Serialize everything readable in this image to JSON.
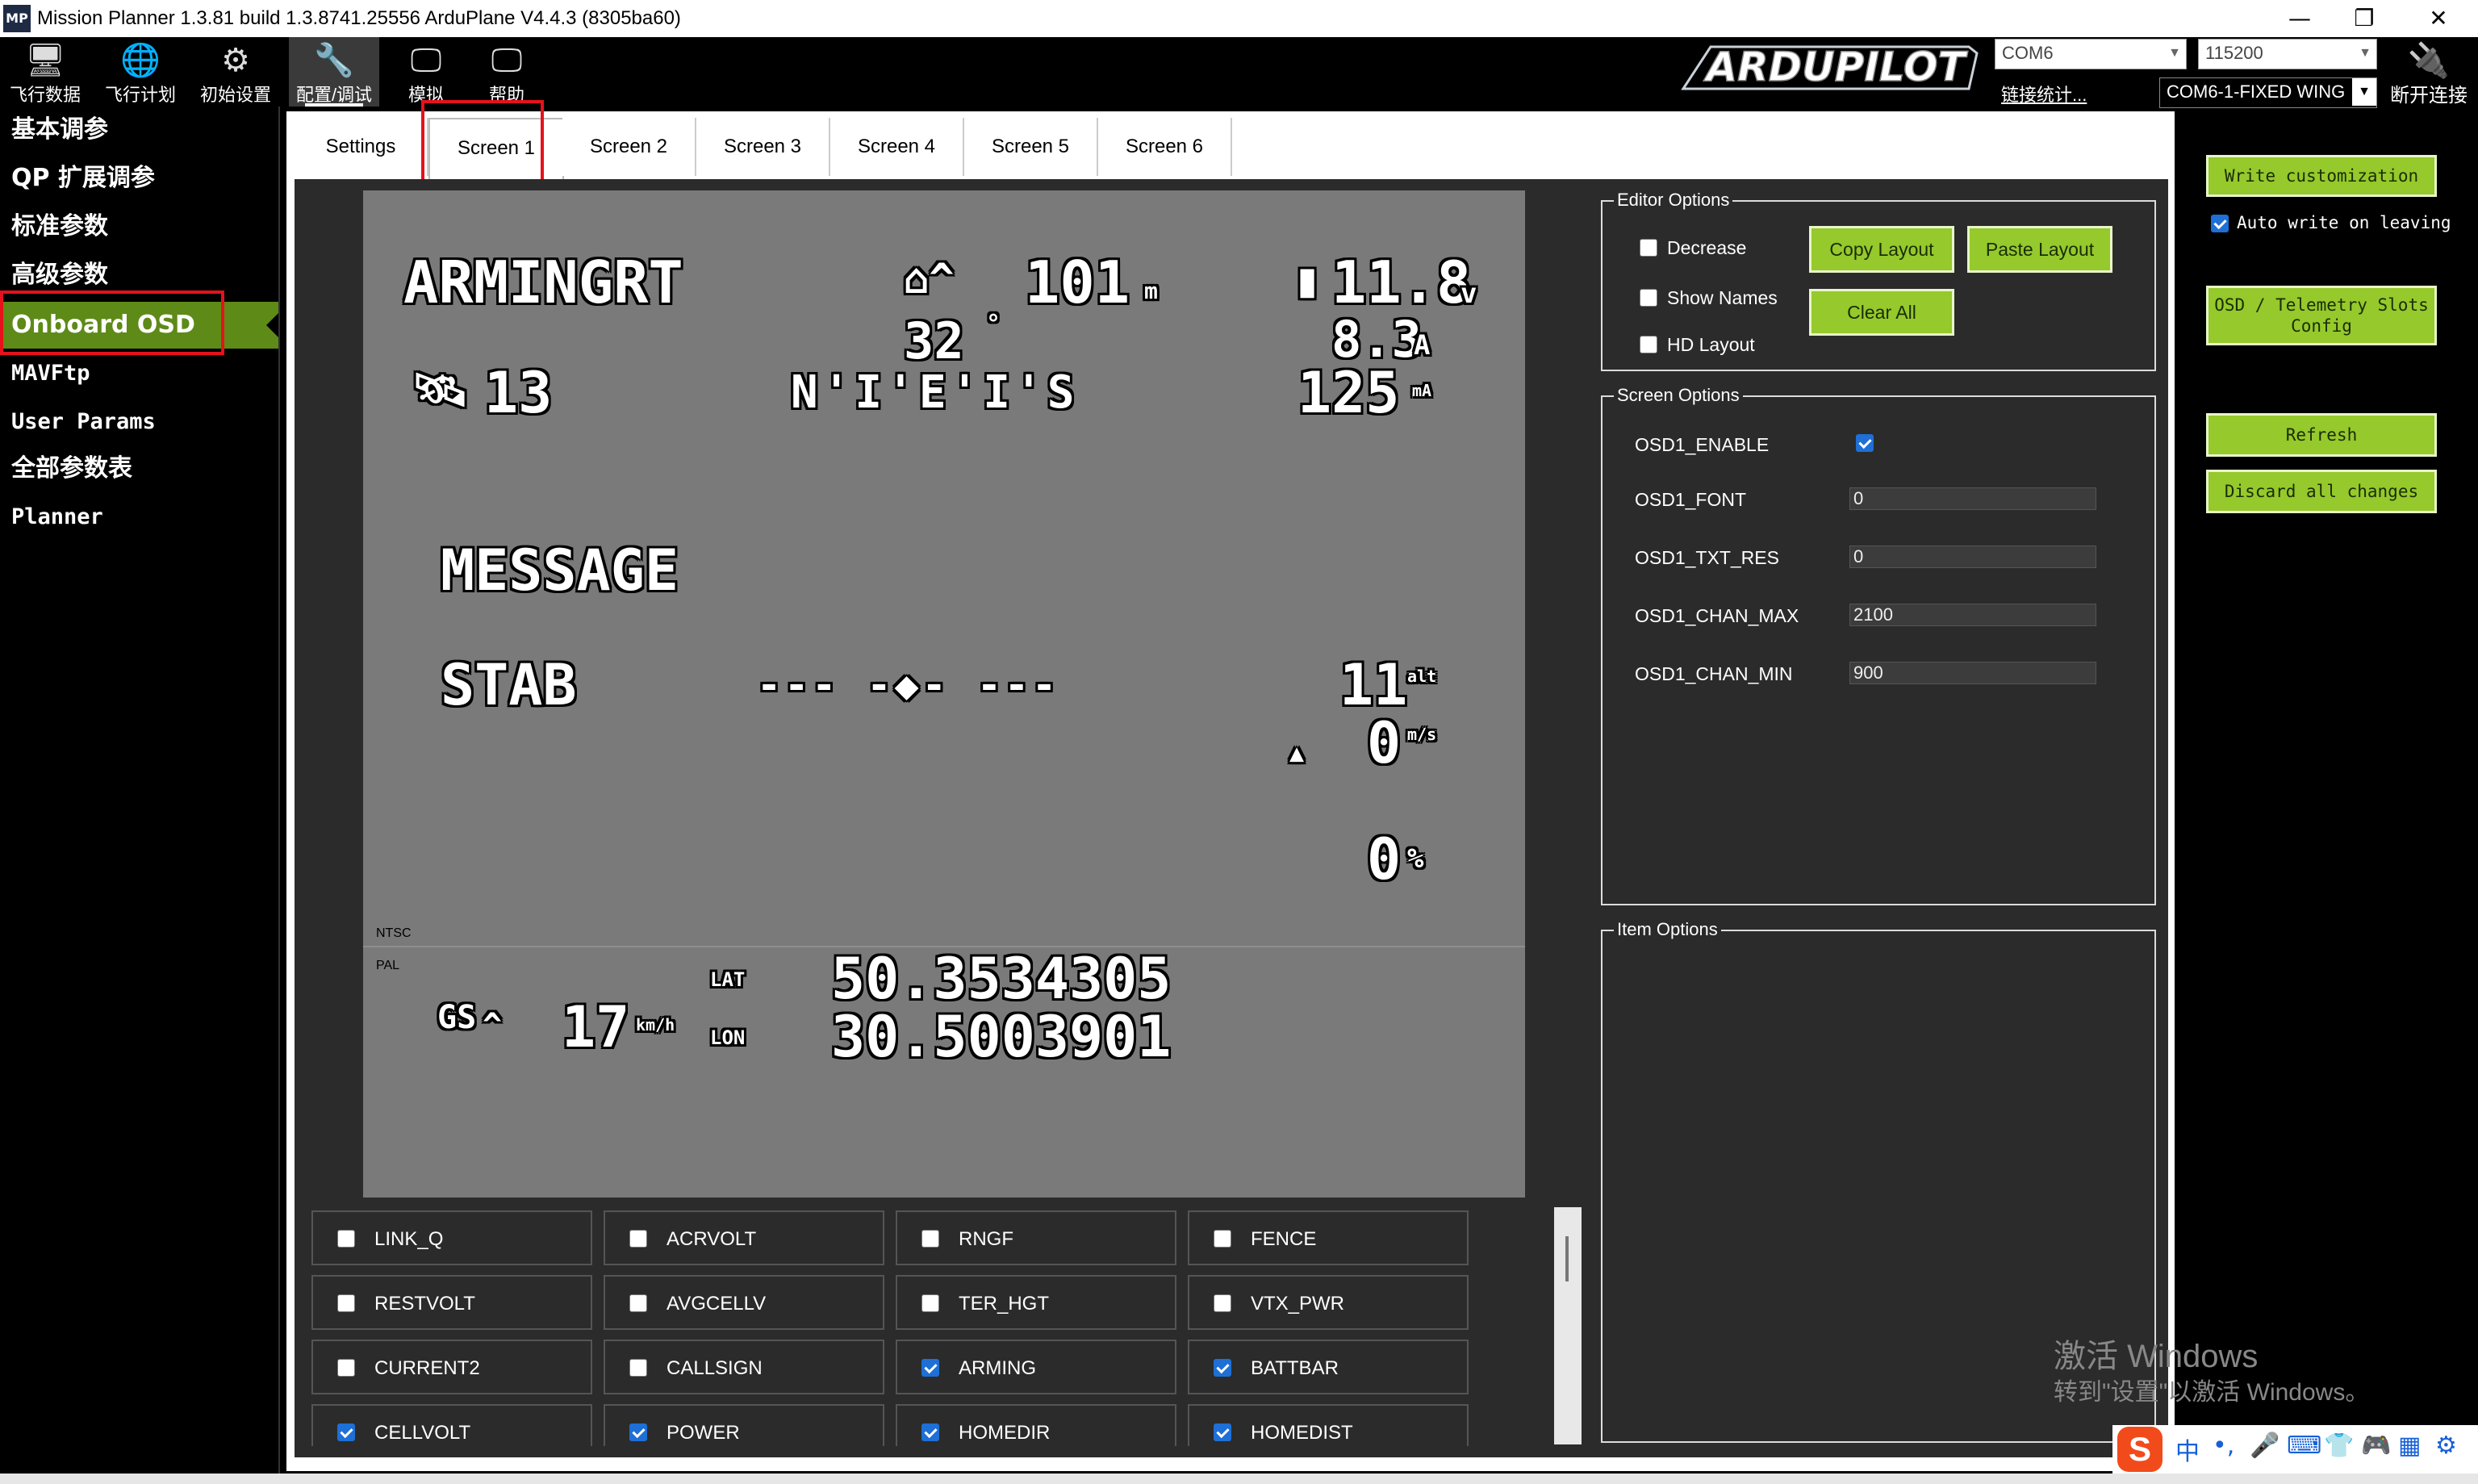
{
  "window": {
    "title": "Mission Planner 1.3.81 build 1.3.8741.25556 ArduPlane V4.4.3 (8305ba60)",
    "app_icon": "MP",
    "minimize": "—",
    "maximize": "❐",
    "close": "✕"
  },
  "toolbar": {
    "items": [
      {
        "label": "飞行数据",
        "icon": "flight-data-icon"
      },
      {
        "label": "飞行计划",
        "icon": "flight-plan-icon"
      },
      {
        "label": "初始设置",
        "icon": "initial-setup-icon"
      },
      {
        "label": "配置/调试",
        "icon": "config-tuning-icon"
      },
      {
        "label": "模拟",
        "icon": "simulation-icon"
      },
      {
        "label": "帮助",
        "icon": "help-icon"
      }
    ],
    "logo_text": "ARDUPILOT",
    "port": "COM6",
    "baud": "115200",
    "link_stats": "链接统计...",
    "profile": "COM6-1-FIXED WING",
    "disconnect": "断开连接"
  },
  "sidebar": {
    "items": [
      {
        "label": "基本调参"
      },
      {
        "label": "QP 扩展调参"
      },
      {
        "label": "标准参数"
      },
      {
        "label": "高级参数"
      },
      {
        "label": "Onboard OSD"
      },
      {
        "label": "MAVFtp"
      },
      {
        "label": "User Params"
      },
      {
        "label": "全部参数表"
      },
      {
        "label": "Planner"
      }
    ],
    "active": "Onboard OSD"
  },
  "tabs": [
    "Settings",
    "Screen 1",
    "Screen 2",
    "Screen 3",
    "Screen 4",
    "Screen 5",
    "Screen 6"
  ],
  "active_tab": "Screen 1",
  "osd_preview": {
    "arming": "ARMINGRT",
    "home_alt": "101",
    "home_alt_unit": "m",
    "home_dir": "32",
    "home_dir_unit": "°",
    "battery": "11.8",
    "battery_unit": "v",
    "current": "8.3",
    "current_unit": "A",
    "mah": "125",
    "mah_unit": "mA",
    "sats": "13",
    "compass": "N'I'E'I'S",
    "message": "MESSAGE",
    "mode": "STAB",
    "horizon": "--- -◆- ---",
    "alt": "11",
    "alt_unit": "alt",
    "vspeed": "0",
    "vspeed_unit": "m/s",
    "throttle": "0",
    "throttle_unit": "%",
    "ntsc": "NTSC",
    "pal": "PAL",
    "gs_label": "GS",
    "gs_value": "17",
    "gs_unit": "km/h",
    "lat_label": "LAT",
    "lat": "50.3534305",
    "lon_label": "LON",
    "lon": "30.5003901"
  },
  "editor_options": {
    "title": "Editor Options",
    "decrease": "Decrease",
    "show_names": "Show Names",
    "hd_layout": "HD Layout",
    "copy_layout": "Copy Layout",
    "paste_layout": "Paste Layout",
    "clear_all": "Clear All"
  },
  "screen_options": {
    "title": "Screen Options",
    "rows": [
      {
        "name": "OSD1_ENABLE",
        "value": "",
        "checked": true
      },
      {
        "name": "OSD1_FONT",
        "value": "0"
      },
      {
        "name": "OSD1_TXT_RES",
        "value": "0"
      },
      {
        "name": "OSD1_CHAN_MAX",
        "value": "2100"
      },
      {
        "name": "OSD1_CHAN_MIN",
        "value": "900"
      }
    ]
  },
  "item_options": {
    "title": "Item Options"
  },
  "items": [
    {
      "label": "LINK_Q",
      "checked": false
    },
    {
      "label": "ACRVOLT",
      "checked": false
    },
    {
      "label": "RNGF",
      "checked": false
    },
    {
      "label": "FENCE",
      "checked": false
    },
    {
      "label": "RESTVOLT",
      "checked": false
    },
    {
      "label": "AVGCELLV",
      "checked": false
    },
    {
      "label": "TER_HGT",
      "checked": false
    },
    {
      "label": "VTX_PWR",
      "checked": false
    },
    {
      "label": "CURRENT2",
      "checked": false
    },
    {
      "label": "CALLSIGN",
      "checked": false
    },
    {
      "label": "ARMING",
      "checked": true
    },
    {
      "label": "BATTBAR",
      "checked": true
    },
    {
      "label": "CELLVOLT",
      "checked": true
    },
    {
      "label": "POWER",
      "checked": true
    },
    {
      "label": "HOMEDIR",
      "checked": true
    },
    {
      "label": "HOMEDIST",
      "checked": true
    }
  ],
  "right_panel": {
    "write": "Write customization",
    "auto_write": "Auto write on leaving",
    "slots": "OSD / Telemetry Slots Config",
    "refresh": "Refresh",
    "discard": "Discard all changes"
  },
  "watermark": {
    "line1": "激活 Windows",
    "line2": "转到\"设置\"以激活 Windows。"
  },
  "ime": {
    "logo": "S",
    "glyphs": [
      "中",
      "•,",
      "🎤",
      "⌨",
      "👕",
      "🎮",
      "▦",
      "⚙"
    ]
  }
}
